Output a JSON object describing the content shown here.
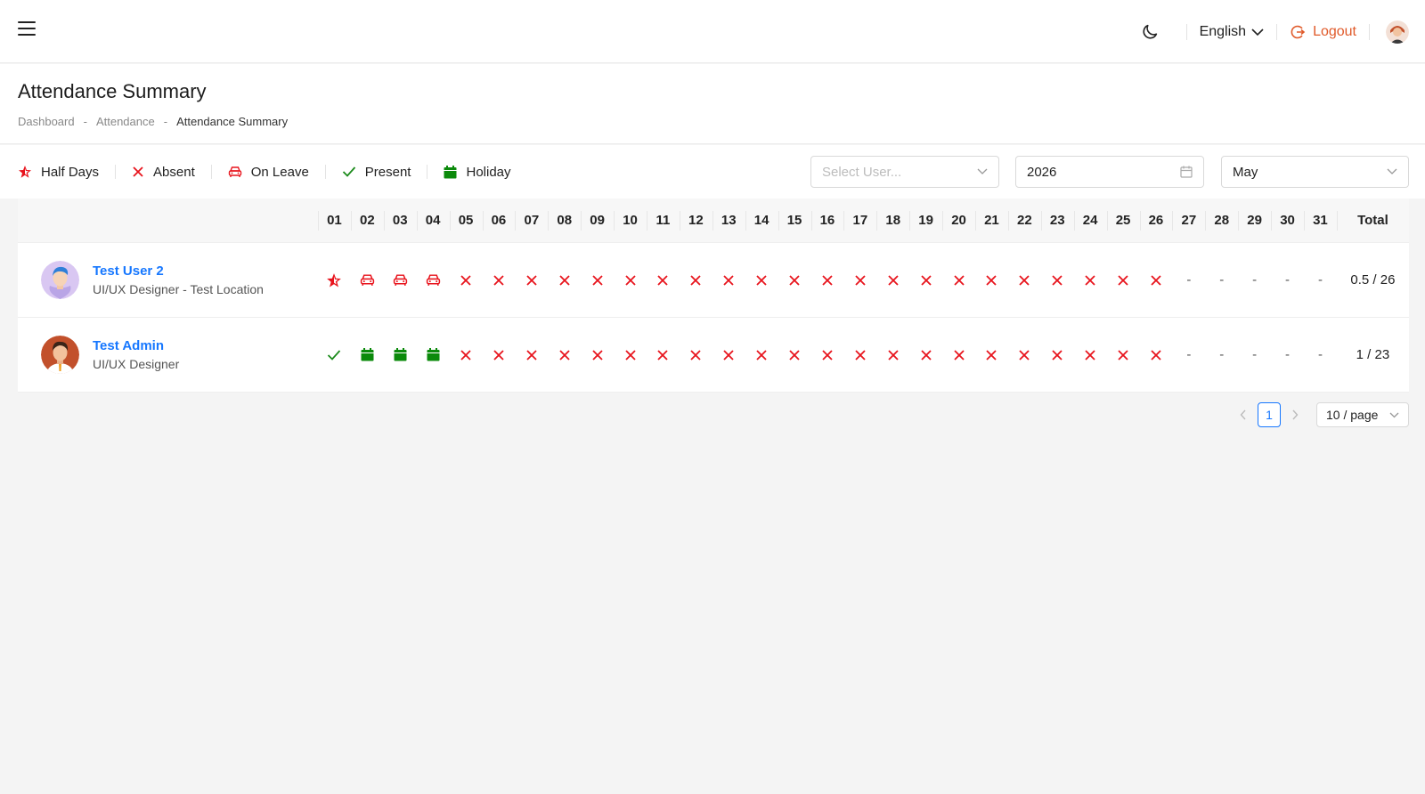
{
  "header": {
    "language": "English",
    "logout_label": "Logout"
  },
  "page": {
    "title": "Attendance Summary",
    "breadcrumb": [
      "Dashboard",
      "Attendance",
      "Attendance Summary"
    ]
  },
  "legend": [
    {
      "label": "Half Days",
      "icon": "half-day-star-icon",
      "color": "#e8141d"
    },
    {
      "label": "Absent",
      "icon": "absent-x-icon",
      "color": "#e8141d"
    },
    {
      "label": "On Leave",
      "icon": "leave-car-icon",
      "color": "#e8141d"
    },
    {
      "label": "Present",
      "icon": "present-check-icon",
      "color": "#1a8a1a"
    },
    {
      "label": "Holiday",
      "icon": "holiday-calendar-icon",
      "color": "#0b8a0b"
    }
  ],
  "filters": {
    "user_placeholder": "Select User...",
    "year": "2026",
    "month": "May"
  },
  "table": {
    "days": [
      "01",
      "02",
      "03",
      "04",
      "05",
      "06",
      "07",
      "08",
      "09",
      "10",
      "11",
      "12",
      "13",
      "14",
      "15",
      "16",
      "17",
      "18",
      "19",
      "20",
      "21",
      "22",
      "23",
      "24",
      "25",
      "26",
      "27",
      "28",
      "29",
      "30",
      "31"
    ],
    "total_label": "Total",
    "rows": [
      {
        "name": "Test User 2",
        "role": "UI/UX Designer - Test Location",
        "avatar": "avatar-blue-hair",
        "statuses": [
          "half",
          "leave",
          "leave",
          "leave",
          "absent",
          "absent",
          "absent",
          "absent",
          "absent",
          "absent",
          "absent",
          "absent",
          "absent",
          "absent",
          "absent",
          "absent",
          "absent",
          "absent",
          "absent",
          "absent",
          "absent",
          "absent",
          "absent",
          "absent",
          "absent",
          "absent",
          "none",
          "none",
          "none",
          "none",
          "none"
        ],
        "total": "0.5 / 26"
      },
      {
        "name": "Test Admin",
        "role": "UI/UX Designer",
        "avatar": "avatar-orange-hair",
        "statuses": [
          "present",
          "holiday",
          "holiday",
          "holiday",
          "absent",
          "absent",
          "absent",
          "absent",
          "absent",
          "absent",
          "absent",
          "absent",
          "absent",
          "absent",
          "absent",
          "absent",
          "absent",
          "absent",
          "absent",
          "absent",
          "absent",
          "absent",
          "absent",
          "absent",
          "absent",
          "absent",
          "none",
          "none",
          "none",
          "none",
          "none"
        ],
        "total": "1 / 23"
      }
    ],
    "empty_mark": "-"
  },
  "pagination": {
    "current_page": "1",
    "page_size": "10 / page"
  },
  "colors": {
    "red": "#e8141d",
    "green": "#1a8a1a",
    "link": "#1677ff",
    "logout": "#e05a2a"
  }
}
